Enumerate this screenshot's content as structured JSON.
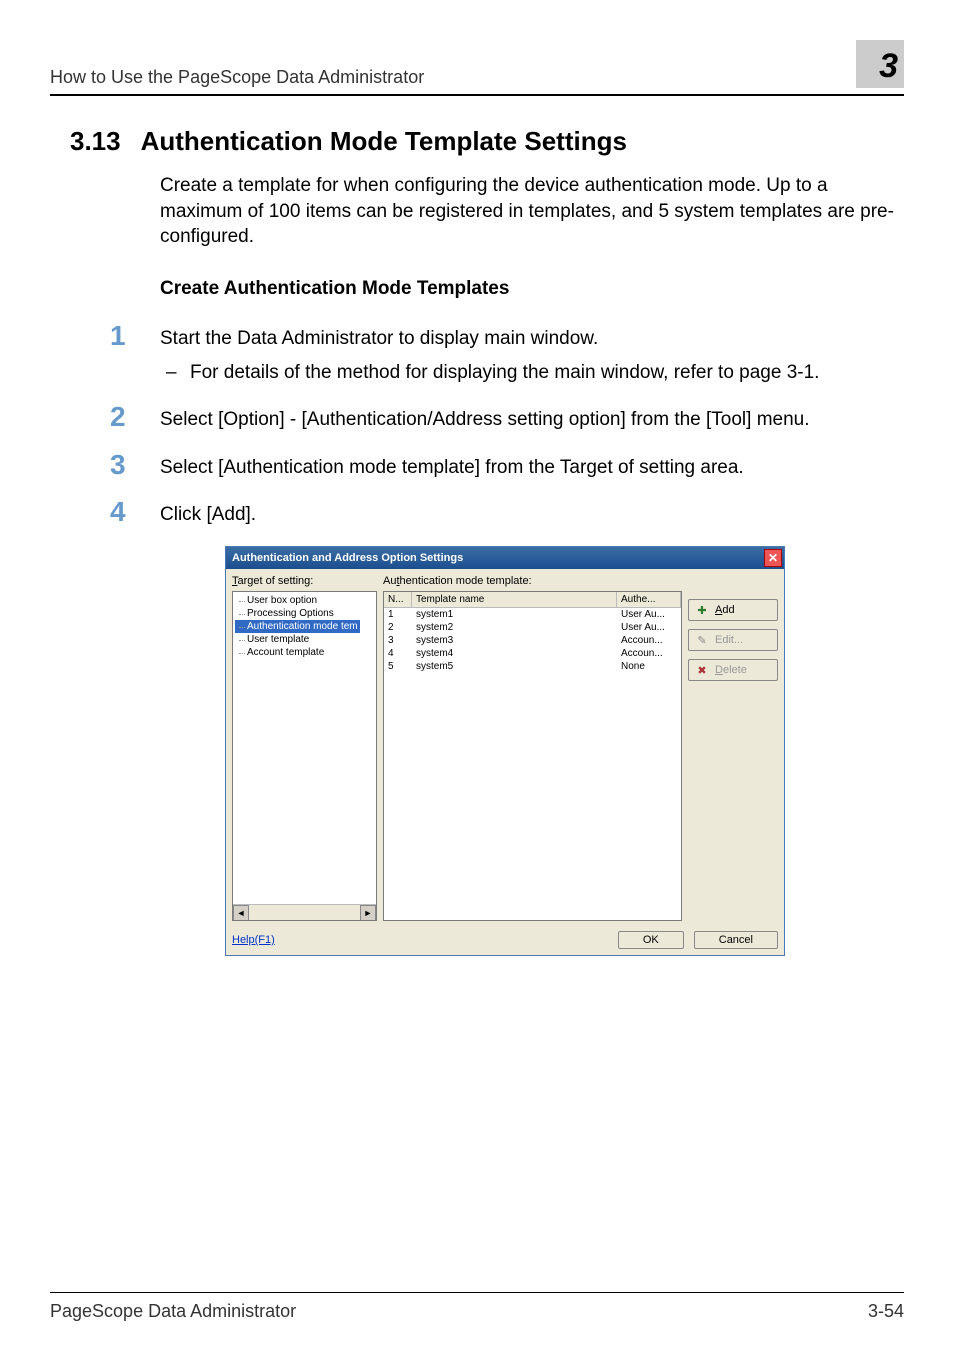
{
  "header": {
    "title": "How to Use the PageScope Data Administrator",
    "chapter_num": "3"
  },
  "section": {
    "number": "3.13",
    "title": "Authentication Mode Template Settings",
    "intro": "Create a template for when configuring the device authentication mode. Up to a maximum of 100 items can be registered in templates, and 5 system templates are pre-configured.",
    "sub_heading": "Create Authentication Mode Templates"
  },
  "steps": [
    {
      "num": "1",
      "text": "Start the Data Administrator to display main window.",
      "sub": "For details of the method for displaying the main window, refer to page 3-1."
    },
    {
      "num": "2",
      "text": "Select [Option] - [Authentication/Address setting option] from the [Tool] menu."
    },
    {
      "num": "3",
      "text": "Select [Authentication mode template] from the Target of setting area."
    },
    {
      "num": "4",
      "text": "Click [Add]."
    }
  ],
  "dialog": {
    "title": "Authentication and Address Option Settings",
    "target_label": "Target of setting:",
    "list_label": "Authentication mode template:",
    "tree": [
      "User box option",
      "Processing Options",
      "Authentication mode tem",
      "User template",
      "Account template"
    ],
    "tree_selected_index": 2,
    "list_headers": {
      "n": "N...",
      "name": "Template name",
      "auth": "Authe..."
    },
    "rows": [
      {
        "n": "1",
        "name": "system1",
        "auth": "User Au..."
      },
      {
        "n": "2",
        "name": "system2",
        "auth": "User Au..."
      },
      {
        "n": "3",
        "name": "system3",
        "auth": "Accoun..."
      },
      {
        "n": "4",
        "name": "system4",
        "auth": "Accoun..."
      },
      {
        "n": "5",
        "name": "system5",
        "auth": "None"
      }
    ],
    "buttons": {
      "add": "Add",
      "edit": "Edit...",
      "delete": "Delete"
    },
    "help": "Help(F1)",
    "ok": "OK",
    "cancel": "Cancel"
  },
  "footer": {
    "left": "PageScope Data Administrator",
    "right": "3-54"
  }
}
